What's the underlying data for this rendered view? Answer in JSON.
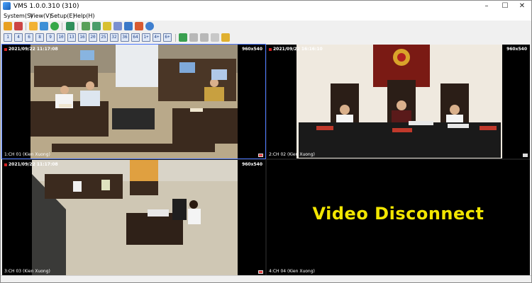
{
  "window": {
    "title": "VMS 1.0.0.310 (310)",
    "minimize_glyph": "–",
    "maximize_glyph": "☐",
    "close_glyph": "✕"
  },
  "menu": [
    {
      "label": "System(S)"
    },
    {
      "label": "View(V)"
    },
    {
      "label": "Setup(E)"
    },
    {
      "label": "Help(H)"
    }
  ],
  "toolbar1_icons": [
    "login-icon",
    "logout-icon",
    "folder-open-icon",
    "device-tree-icon",
    "record-icon",
    "monitor-icon",
    "playback-icon",
    "snapshot-icon",
    "search-icon",
    "settings-icon",
    "display-icon",
    "map-icon",
    "user-icon",
    "about-icon"
  ],
  "layout_buttons": [
    "1",
    "4",
    "6",
    "8",
    "9",
    "10",
    "13",
    "16",
    "20",
    "25",
    "32",
    "36",
    "64",
    "1+",
    "4+",
    "6+"
  ],
  "grid_tools": [
    "fullscreen-icon",
    "prev-page-icon",
    "next-page-icon",
    "sequence-icon",
    "close-all-icon"
  ],
  "channels": [
    {
      "timestamp": "2021/09/22 11:17:08",
      "resolution": "960x540",
      "name": "1:CH 01 (Kien Xuong)",
      "state": "live"
    },
    {
      "timestamp": "2021/09/22 16:16:10",
      "resolution": "960x540",
      "name": "2:CH 02 (Kien Xuong)",
      "state": "live"
    },
    {
      "timestamp": "2021/09/22 11:17:08",
      "resolution": "960x540",
      "name": "3:CH 03 (Kien Xuong)",
      "state": "live"
    },
    {
      "timestamp": "",
      "resolution": "",
      "name": "4:CH 04 (Kien Xuong)",
      "state": "disconnected",
      "message": "Video Disconnect"
    }
  ],
  "colors": {
    "accent": "#4f7bff",
    "disconnect_text": "#f2e600",
    "record_dot": "#d02020"
  }
}
